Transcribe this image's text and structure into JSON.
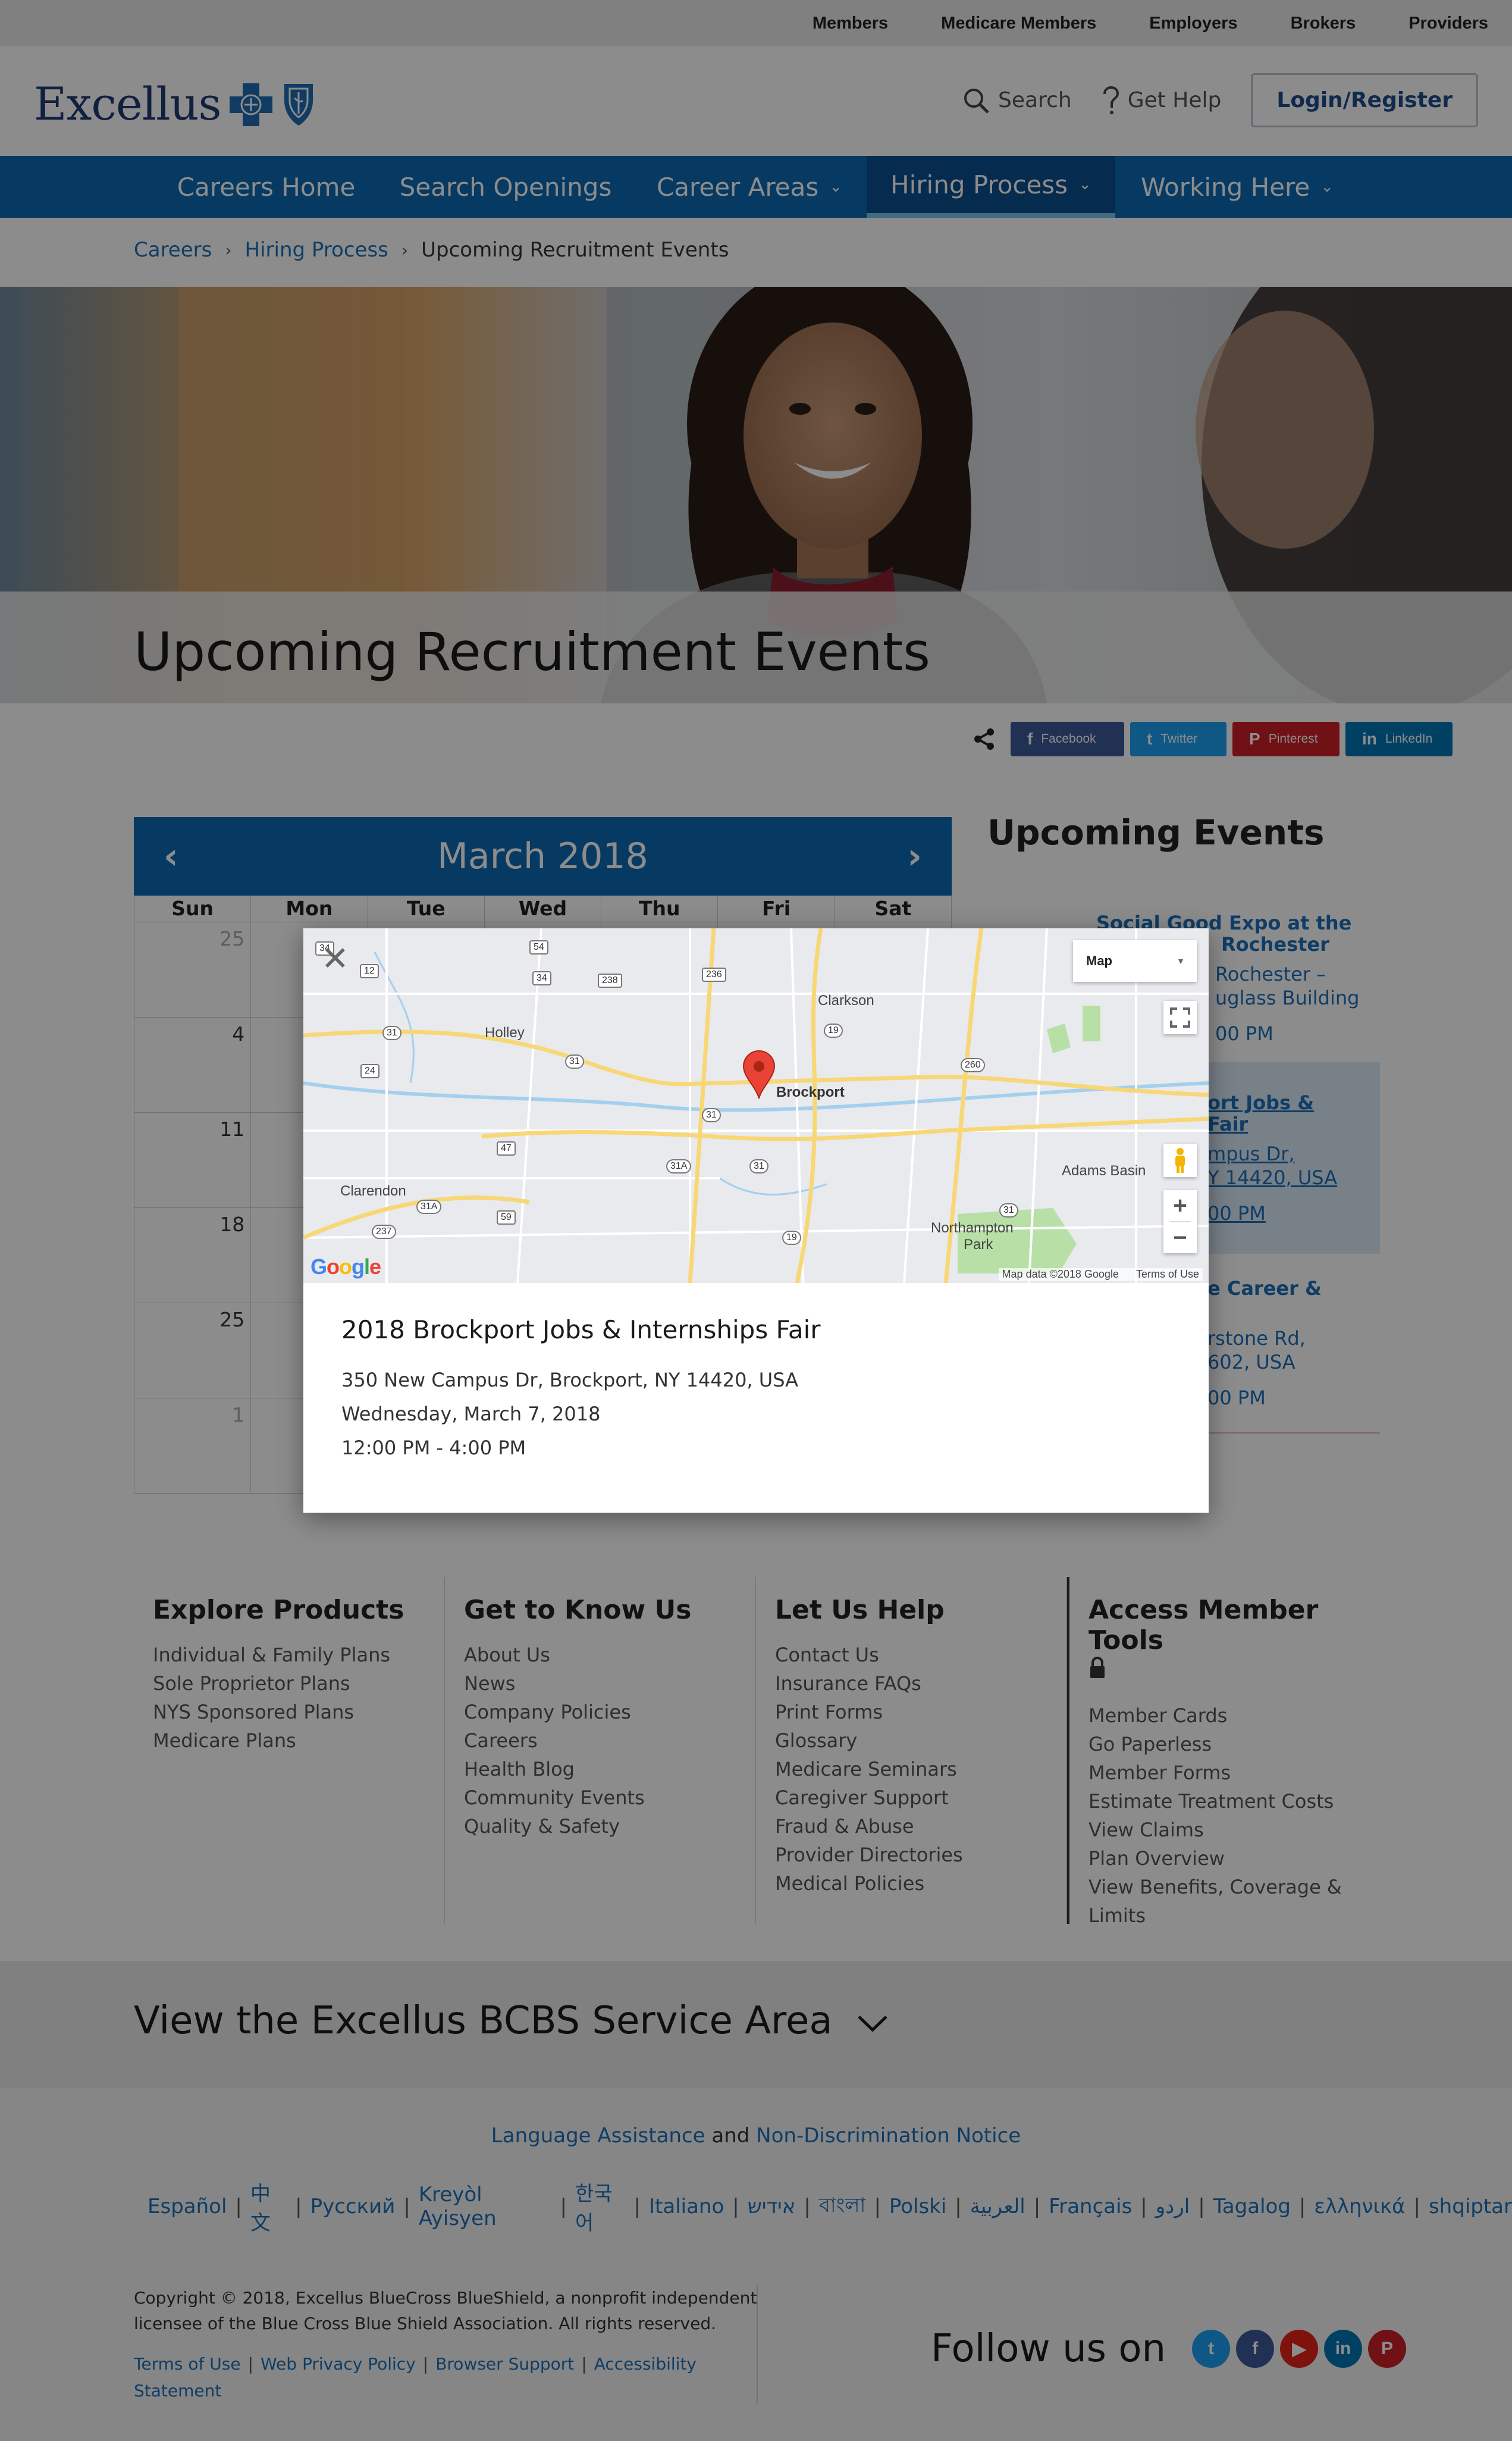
{
  "utility_nav": [
    "Members",
    "Medicare Members",
    "Employers",
    "Brokers",
    "Providers"
  ],
  "header": {
    "logo_text": "Excellus",
    "search_label": "Search",
    "help_label": "Get Help",
    "login_label": "Login/Register"
  },
  "main_nav": [
    {
      "label": "Careers Home"
    },
    {
      "label": "Search Openings"
    },
    {
      "label": "Career Areas"
    },
    {
      "label": "Hiring Process"
    },
    {
      "label": "Working Here"
    }
  ],
  "breadcrumb": [
    "Careers",
    "Hiring Process",
    "Upcoming Recruitment Events"
  ],
  "hero": {
    "title": "Upcoming Recruitment Events"
  },
  "share": [
    "Facebook",
    "Twitter",
    "Pinterest",
    "LinkedIn"
  ],
  "calendar": {
    "month_title": "March 2018",
    "prev": "‹",
    "next": "›",
    "weekdays": [
      "Sun",
      "Mon",
      "Tue",
      "Wed",
      "Thu",
      "Fri",
      "Sat"
    ],
    "sundays": [
      "25",
      "4",
      "11",
      "18",
      "25",
      "1"
    ]
  },
  "events": {
    "title": "Upcoming Events",
    "items": [
      {
        "title_a": "Social Good Expo at the",
        "title_b": "Rochester",
        "loc_a": "Rochester –",
        "loc_b": "uglass Building",
        "time": "00 PM"
      },
      {
        "title_a": "ort Jobs &",
        "title_b": "Fair",
        "loc_a": "mpus Dr,",
        "loc_b": "Y 14420, USA",
        "time": "00 PM"
      },
      {
        "title_a": "e Career &",
        "loc_a": "rstone Rd,",
        "loc_b": "602, USA",
        "time": "00 PM"
      }
    ]
  },
  "modal": {
    "title": "2018 Brockport Jobs & Internships Fair",
    "address": "350 New Campus Dr, Brockport, NY 14420, USA",
    "date": "Wednesday, March 7, 2018",
    "time": "12:00 PM - 4:00 PM",
    "close": "✕"
  },
  "map": {
    "type_label": "Map",
    "zoom_in": "+",
    "zoom_out": "−",
    "google": "Google",
    "data_credit": "Map data ©2018 Google",
    "terms": "Terms of Use",
    "places": [
      "Clarkson",
      "Holley",
      "Brockport",
      "Adams Basin",
      "Clarendon",
      "Northampton",
      "Park"
    ],
    "routes": [
      "34",
      "12",
      "54",
      "34",
      "238",
      "236",
      "19",
      "260",
      "31",
      "24",
      "31",
      "31",
      "47",
      "31A",
      "31",
      "59",
      "31A",
      "237",
      "19",
      "31"
    ]
  },
  "footer": {
    "columns": [
      {
        "title": "Explore Products",
        "links": [
          "Individual & Family Plans",
          "Sole Proprietor Plans",
          "NYS Sponsored Plans",
          "Medicare Plans"
        ]
      },
      {
        "title": "Get to Know Us",
        "links": [
          "About Us",
          "News",
          "Company Policies",
          "Careers",
          "Health Blog",
          "Community Events",
          "Quality & Safety"
        ]
      },
      {
        "title": "Let Us Help",
        "links": [
          "Contact Us",
          "Insurance FAQs",
          "Print Forms",
          "Glossary",
          "Medicare Seminars",
          "Caregiver Support",
          "Fraud & Abuse",
          "Provider Directories",
          "Medical Policies"
        ]
      },
      {
        "title": "Access Member Tools",
        "links": [
          "Member Cards",
          "Go Paperless",
          "Member Forms",
          "Estimate Treatment Costs",
          "View Claims",
          "Plan Overview",
          "View Benefits, Coverage &",
          "Limits"
        ]
      }
    ],
    "service_area": "View the Excellus BCBS Service Area",
    "notice_a": "Language Assistance",
    "notice_and": "and",
    "notice_b": "Non-Discrimination Notice",
    "languages": [
      "Español",
      "中文",
      "Русский",
      "Kreyòl Ayisyen",
      "한국어",
      "Italiano",
      "אידיש",
      "বাংলা",
      "Polski",
      "العربية",
      "Français",
      "اردو",
      "Tagalog",
      "ελληνικά",
      "shqiptar"
    ],
    "copyright_a": "Copyright © 2018, Excellus BlueCross BlueShield, a nonprofit independent",
    "copyright_b": "licensee of the Blue Cross Blue Shield Association. All rights reserved.",
    "legal": [
      "Terms of Use",
      "Web Privacy Policy",
      "Browser Support",
      "Accessibility"
    ],
    "legal_tail": "Statement",
    "follow": "Follow us on",
    "social": [
      {
        "name": "twitter-icon",
        "glyph": "t",
        "color": "#1da1f2"
      },
      {
        "name": "facebook-icon",
        "glyph": "f",
        "color": "#3b5998"
      },
      {
        "name": "youtube-icon",
        "glyph": "▶",
        "color": "#e62117"
      },
      {
        "name": "linkedin-icon",
        "glyph": "in",
        "color": "#0077b5"
      },
      {
        "name": "pinterest-icon",
        "glyph": "P",
        "color": "#cb2027"
      }
    ]
  },
  "colors": {
    "brand_blue": "#0b6ab5",
    "nav_active": "#0a4f8f",
    "link": "#1d6fb8"
  }
}
